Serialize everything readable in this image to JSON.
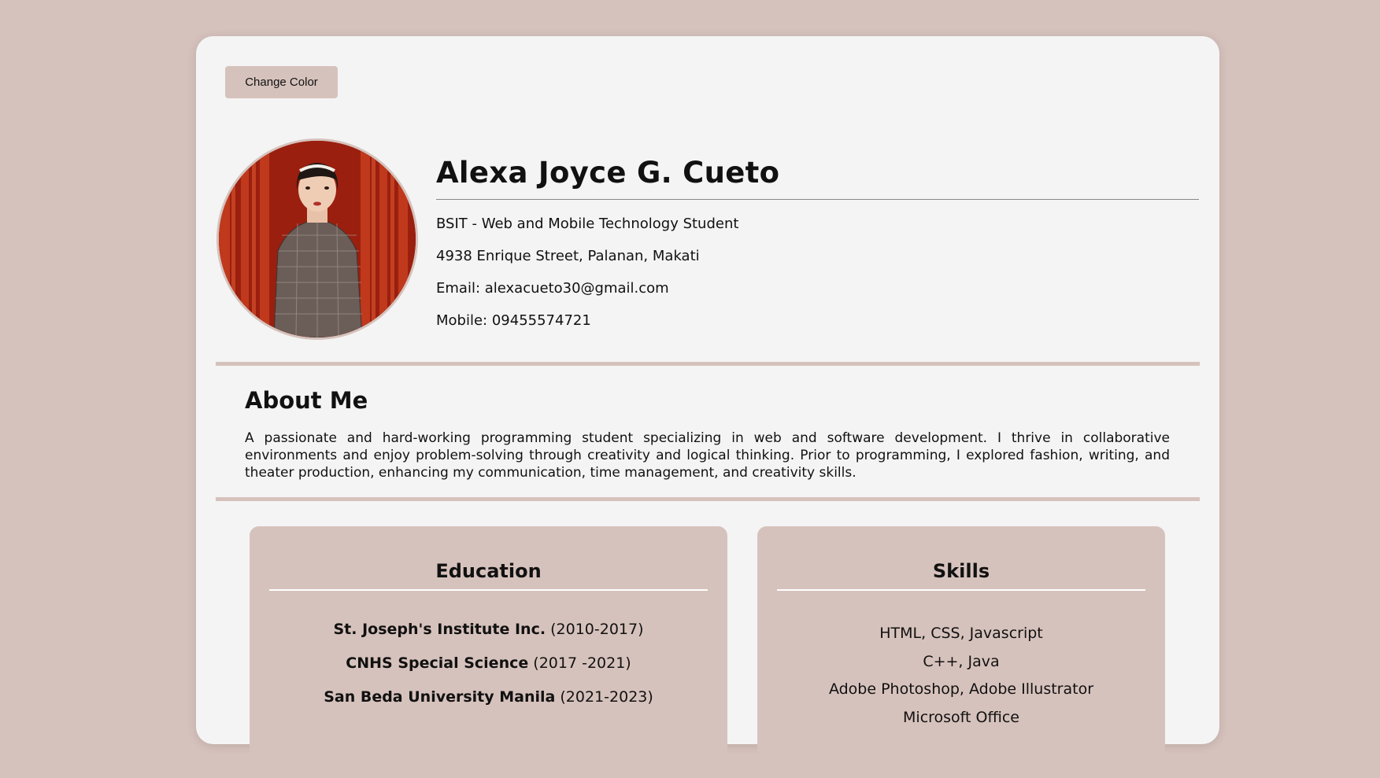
{
  "toolbar": {
    "change_color_label": "Change Color"
  },
  "profile": {
    "name": "Alexa Joyce G. Cueto",
    "program": "BSIT - Web and Mobile Technology Student",
    "address": "4938 Enrique Street, Palanan, Makati",
    "email": "Email: alexacueto30@gmail.com",
    "mobile": "Mobile: 09455574721"
  },
  "about": {
    "title": "About Me",
    "text": "A passionate and hard-working programming student specializing in web and software development. I thrive in collaborative environments and enjoy problem-solving through creativity and logical thinking. Prior to programming, I explored fashion, writing, and theater production, enhancing my communication, time management, and creativity skills."
  },
  "education": {
    "title": "Education",
    "items": [
      {
        "school": "St. Joseph's Institute Inc.",
        "years": " (2010-2017)"
      },
      {
        "school": "CNHS Special Science",
        "years": " (2017 -2021)"
      },
      {
        "school": "San Beda University Manila",
        "years": " (2021-2023)"
      }
    ]
  },
  "skills": {
    "title": "Skills",
    "items": [
      "HTML, CSS, Javascript",
      "C++, Java",
      "Adobe Photoshop, Adobe Illustrator",
      "Microsoft Office"
    ]
  },
  "colors": {
    "background": "#d6c2bc",
    "card": "#f4f4f4",
    "accent": "#d6c2bc"
  }
}
